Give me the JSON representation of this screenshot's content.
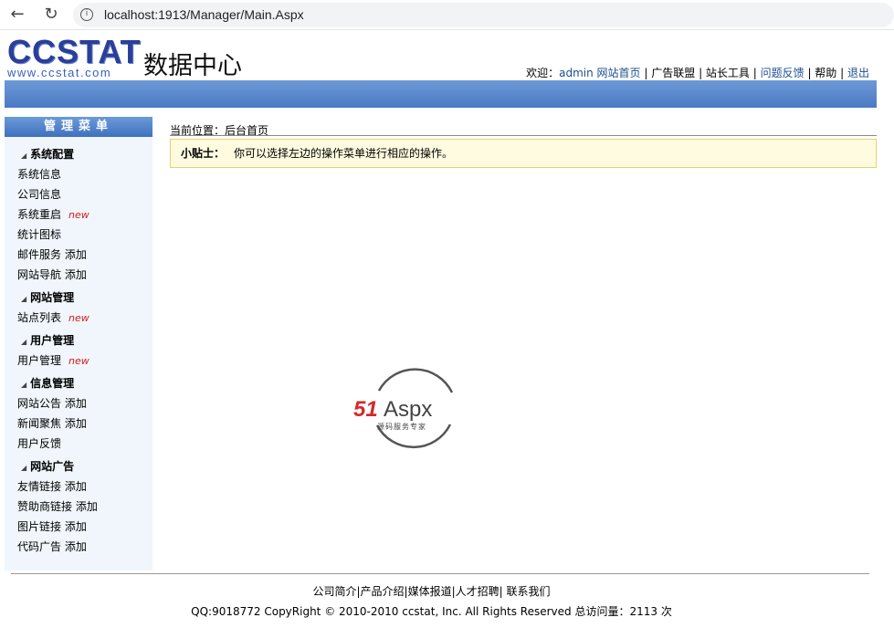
{
  "browser": {
    "url": "localhost:1913/Manager/Main.Aspx"
  },
  "logo": {
    "text": "CCSTAT",
    "domain": "www.ccstat.com",
    "subtitle": "数据中心"
  },
  "top": {
    "welcome": "欢迎：",
    "user": "admin",
    "links": [
      "网站首页",
      "广告联盟",
      "站长工具",
      "问题反馈",
      "帮助",
      "退出"
    ]
  },
  "sidebar": {
    "title": "管理菜单",
    "groups": [
      {
        "label": "系统配置",
        "items": [
          {
            "label": "系统信息"
          },
          {
            "label": "公司信息"
          },
          {
            "label": "系统重启",
            "badge": "new"
          },
          {
            "label": "统计图标"
          },
          {
            "label": "邮件服务",
            "add": "添加"
          },
          {
            "label": "网站导航",
            "add": "添加"
          }
        ]
      },
      {
        "label": "网站管理",
        "items": [
          {
            "label": "站点列表",
            "badge": "new"
          }
        ]
      },
      {
        "label": "用户管理",
        "items": [
          {
            "label": "用户管理",
            "badge": "new"
          }
        ]
      },
      {
        "label": "信息管理",
        "items": [
          {
            "label": "网站公告",
            "add": "添加"
          },
          {
            "label": "新闻聚焦",
            "add": "添加"
          },
          {
            "label": "用户反馈"
          }
        ]
      },
      {
        "label": "网站广告",
        "items": [
          {
            "label": "友情链接",
            "add": "添加"
          },
          {
            "label": "赞助商链接",
            "add": "添加"
          },
          {
            "label": "图片链接",
            "add": "添加"
          },
          {
            "label": "代码广告",
            "add": "添加"
          }
        ]
      }
    ]
  },
  "main": {
    "breadcrumb": "当前位置：后台首页",
    "tip_label": "小贴士：",
    "tip_text": "你可以选择左边的操作菜单进行相应的操作。"
  },
  "watermark": {
    "brand": "51Aspx",
    "tagline": "源码服务专家"
  },
  "footer": {
    "links": "公司简介|产品介绍|媒体报道|人才招聘| 联系我们",
    "copyright": "QQ:9018772 CopyRight © 2010-2010 ccstat, Inc. All Rights Reserved 总访问量：2113 次"
  }
}
